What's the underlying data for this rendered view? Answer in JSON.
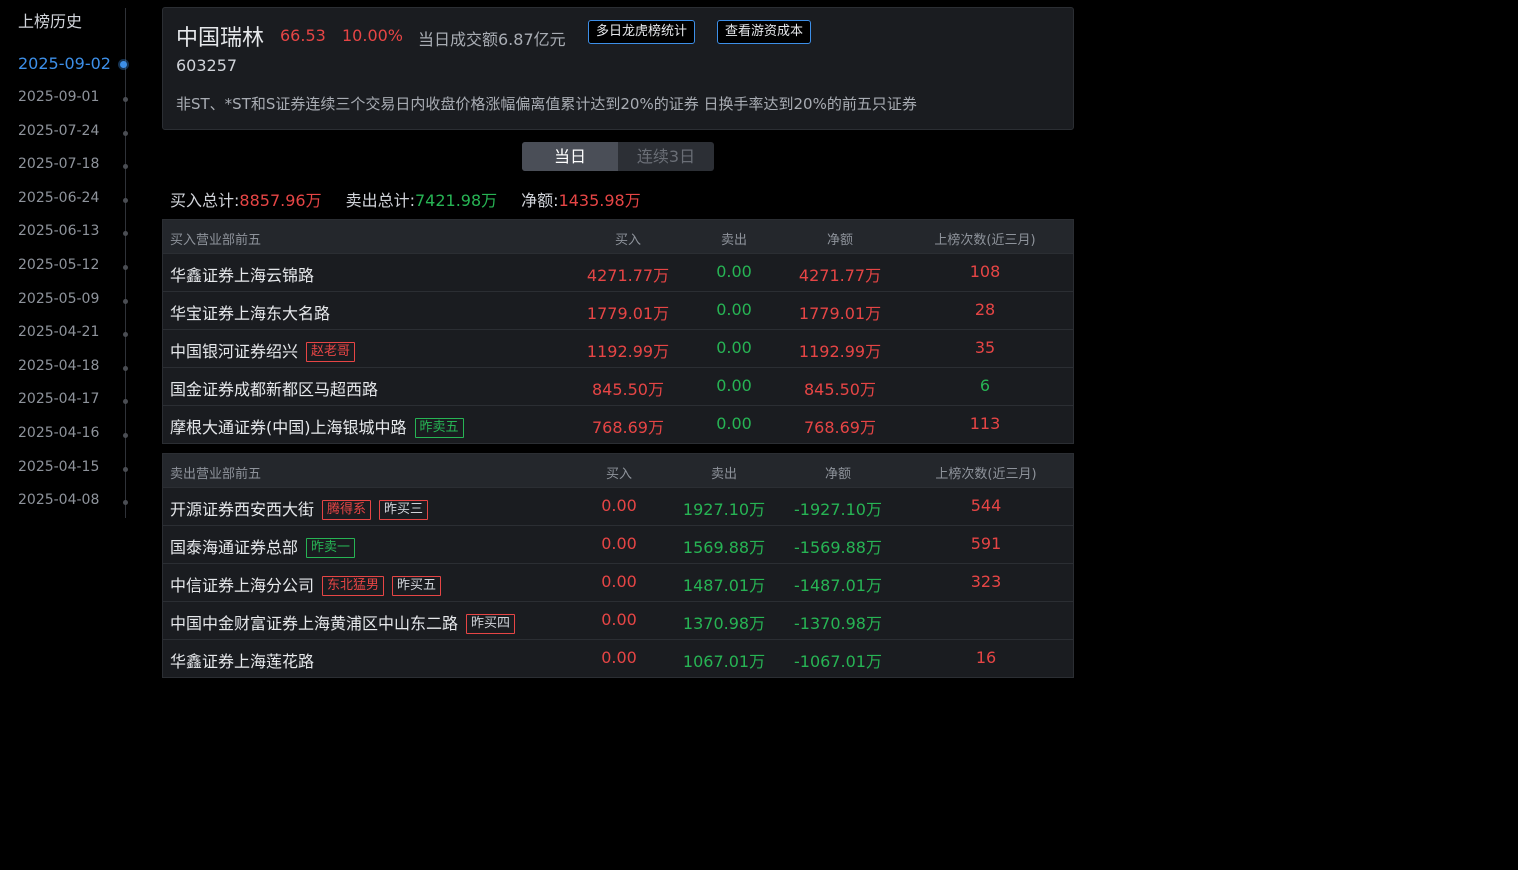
{
  "sidebar": {
    "title": "上榜历史",
    "dates": [
      {
        "label": "2025-09-02",
        "active": true
      },
      {
        "label": "2025-09-01"
      },
      {
        "label": "2025-07-24"
      },
      {
        "label": "2025-07-18"
      },
      {
        "label": "2025-06-24"
      },
      {
        "label": "2025-06-13"
      },
      {
        "label": "2025-05-12"
      },
      {
        "label": "2025-05-09"
      },
      {
        "label": "2025-04-21"
      },
      {
        "label": "2025-04-18"
      },
      {
        "label": "2025-04-17"
      },
      {
        "label": "2025-04-16"
      },
      {
        "label": "2025-04-15"
      },
      {
        "label": "2025-04-08"
      }
    ]
  },
  "stock": {
    "name": "中国瑞林",
    "price": "66.53",
    "change": "10.00%",
    "turnover": "当日成交额6.87亿元",
    "code": "603257",
    "reason": "非ST、*ST和S证券连续三个交易日内收盘价格涨幅偏离值累计达到20%的证券 日换手率达到20%的前五只证券",
    "btn_multi": "多日龙虎榜统计",
    "btn_player": "查看游资成本"
  },
  "tabs": {
    "today": "当日",
    "three_day": "连续3日"
  },
  "totals": {
    "buy_label": "买入总计:",
    "buy_value": "8857.96万",
    "sell_label": "卖出总计:",
    "sell_value": "7421.98万",
    "net_label": "净额:",
    "net_value": "1435.98万"
  },
  "buy_table": {
    "headers": {
      "name": "买入营业部前五",
      "buy": "买入",
      "sell": "卖出",
      "net": "净额",
      "count": "上榜次数(近三月)"
    },
    "rows": [
      {
        "name": "华鑫证券上海云锦路",
        "tags": [],
        "buy": "4271.77万",
        "sell": "0.00",
        "net": "4271.77万",
        "count": "108",
        "count_color": "red"
      },
      {
        "name": "华宝证券上海东大名路",
        "tags": [],
        "buy": "1779.01万",
        "sell": "0.00",
        "net": "1779.01万",
        "count": "28",
        "count_color": "red"
      },
      {
        "name": "中国银河证券绍兴",
        "tags": [
          {
            "text": "赵老哥",
            "style": "red"
          }
        ],
        "buy": "1192.99万",
        "sell": "0.00",
        "net": "1192.99万",
        "count": "35",
        "count_color": "red"
      },
      {
        "name": "国金证券成都新都区马超西路",
        "tags": [],
        "buy": "845.50万",
        "sell": "0.00",
        "net": "845.50万",
        "count": "6",
        "count_color": "green"
      },
      {
        "name": "摩根大通证券(中国)上海银城中路",
        "tags": [
          {
            "text": "昨卖五",
            "style": "green"
          }
        ],
        "buy": "768.69万",
        "sell": "0.00",
        "net": "768.69万",
        "count": "113",
        "count_color": "red"
      }
    ]
  },
  "sell_table": {
    "headers": {
      "name": "卖出营业部前五",
      "buy": "买入",
      "sell": "卖出",
      "net": "净额",
      "count": "上榜次数(近三月)"
    },
    "rows": [
      {
        "name": "开源证券西安西大街",
        "tags": [
          {
            "text": "腾得系",
            "style": "red"
          },
          {
            "text": "昨买三",
            "style": "redbox"
          }
        ],
        "buy": "0.00",
        "sell": "1927.10万",
        "net": "-1927.10万",
        "count": "544",
        "count_color": "red"
      },
      {
        "name": "国泰海通证券总部",
        "tags": [
          {
            "text": "昨卖一",
            "style": "green"
          }
        ],
        "buy": "0.00",
        "sell": "1569.88万",
        "net": "-1569.88万",
        "count": "591",
        "count_color": "red"
      },
      {
        "name": "中信证券上海分公司",
        "tags": [
          {
            "text": "东北猛男",
            "style": "red"
          },
          {
            "text": "昨买五",
            "style": "redbox"
          }
        ],
        "buy": "0.00",
        "sell": "1487.01万",
        "net": "-1487.01万",
        "count": "323",
        "count_color": "red"
      },
      {
        "name": "中国中金财富证券上海黄浦区中山东二路",
        "tags": [
          {
            "text": "昨买四",
            "style": "redbox"
          }
        ],
        "buy": "0.00",
        "sell": "1370.98万",
        "net": "-1370.98万",
        "count": "",
        "count_color": "red"
      },
      {
        "name": "华鑫证券上海莲花路",
        "tags": [],
        "buy": "0.00",
        "sell": "1067.01万",
        "net": "-1067.01万",
        "count": "16",
        "count_color": "red"
      }
    ]
  },
  "colors": {
    "up": "#e64545",
    "down": "#27b454",
    "accent": "#3d8fe8",
    "background": "#000000",
    "panel": "#1a1c20"
  }
}
